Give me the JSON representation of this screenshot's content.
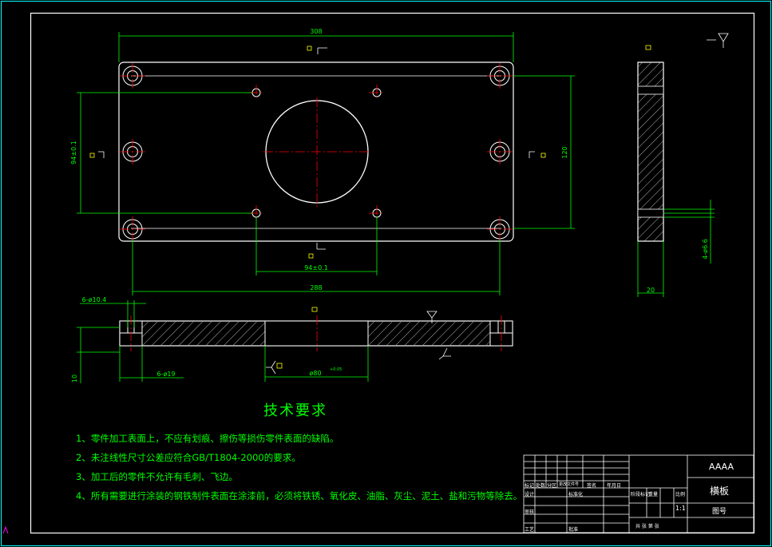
{
  "colors": {
    "background": "#000000",
    "outline": "#ffffff",
    "dimension": "#00ff00",
    "centerline": "#ff0000",
    "frame_accent": "#00ffff",
    "tag": "#ffff00"
  },
  "plan_view": {
    "dim_top": "308",
    "dim_bottom": "288",
    "dim_left": "94±0.1",
    "dim_right": "120",
    "dim_holes": "94±0.1"
  },
  "side_view": {
    "dim_thickness": "20",
    "dim_slot": "4-ø6.6"
  },
  "section_view": {
    "callout_top": "6-ø10.4",
    "callout_bottom": "6-ø19",
    "dim_height": "10",
    "dim_bore": "ø80",
    "dim_bore_tol": "+0.05"
  },
  "tech_requirements": {
    "title": "技术要求",
    "items": [
      "1、零件加工表面上，不应有划痕、擦伤等损伤零件表面的缺陷。",
      "2、未注线性尺寸公差应符合GB/T1804-2000的要求。",
      "3、加工后的零件不允许有毛刺、飞边。",
      "4、所有需要进行涂装的钢铁制件表面在涂漆前，必须将铁锈、氧化皮、油脂、灰尘、泥土、盐和污物等除去。"
    ]
  },
  "title_block": {
    "company": "AAAA",
    "part_name": "横板",
    "drawing_no_label": "图号",
    "scale": "1:1",
    "mark_label": "标记",
    "count_label": "处数",
    "zone_label": "分区",
    "change_label": "更改文件号",
    "sign_label": "签名",
    "date_label": "年月日",
    "design_label": "设计",
    "standard_label": "标准化",
    "check_label": "审核",
    "craft_label": "工艺",
    "approve_label": "批准",
    "stage_label": "阶段标记",
    "weight_label": "重量",
    "ratio_label": "比例",
    "sheet_label": "共 张 第 张"
  }
}
